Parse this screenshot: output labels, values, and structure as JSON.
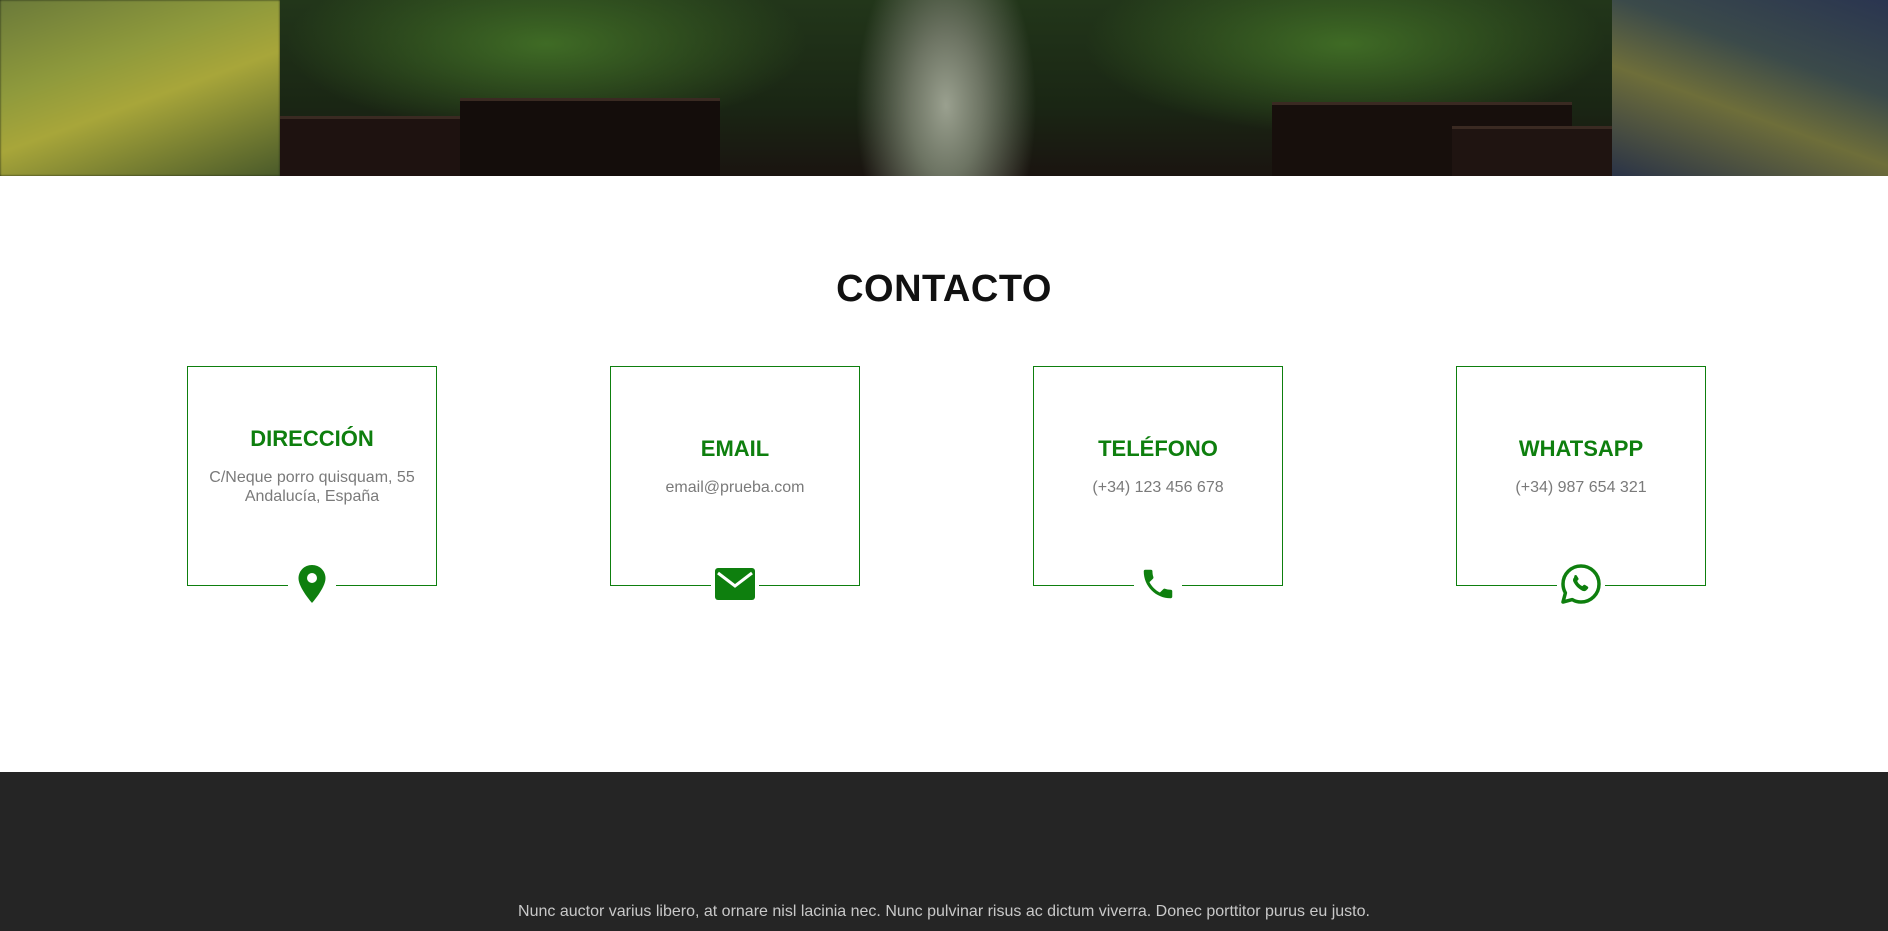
{
  "contact": {
    "title": "CONTACTO",
    "cards": [
      {
        "title": "DIRECCIÓN",
        "lines": [
          "C/Neque porro quisquam, 55",
          "Andalucía, España"
        ],
        "icon": "map-pin-icon"
      },
      {
        "title": "EMAIL",
        "lines": [
          "email@prueba.com"
        ],
        "icon": "envelope-icon"
      },
      {
        "title": "TELÉFONO",
        "lines": [
          "(+34) 123 456 678"
        ],
        "icon": "phone-icon"
      },
      {
        "title": "WHATSAPP",
        "lines": [
          "(+34) 987 654 321"
        ],
        "icon": "whatsapp-icon"
      }
    ]
  },
  "footer": {
    "text": "Nunc auctor varius libero, at ornare nisl lacinia nec. Nunc pulvinar risus ac dictum viverra. Donec porttitor purus eu justo."
  },
  "colors": {
    "accent": "#0e7f0e",
    "footer_bg": "#252525",
    "muted_text": "#7a7a7a"
  }
}
